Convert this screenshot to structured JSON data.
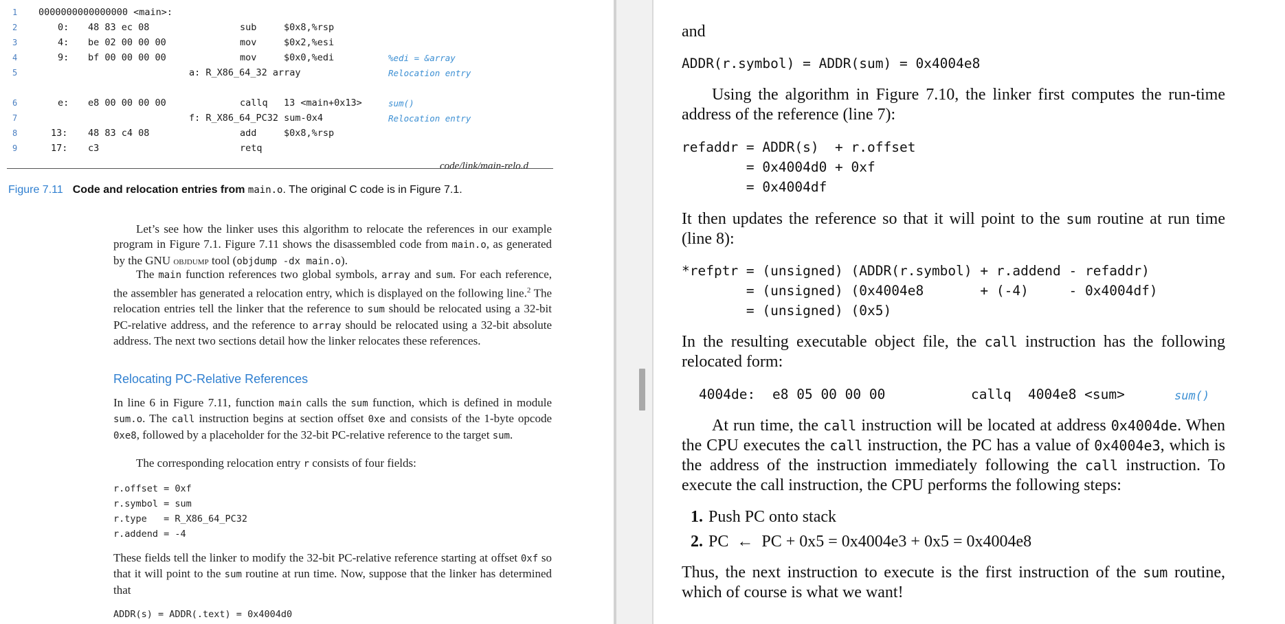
{
  "left": {
    "code_lines": [
      {
        "num": "1",
        "addr": "0000000000000000 <main>:",
        "bytes": "",
        "op": "",
        "args": "",
        "comment": ""
      },
      {
        "num": "2",
        "addr": "0:",
        "bytes": "48 83 ec 08",
        "op": "sub",
        "args": "$0x8,%rsp",
        "comment": ""
      },
      {
        "num": "3",
        "addr": "4:",
        "bytes": "be 02 00 00 00",
        "op": "mov",
        "args": "$0x2,%esi",
        "comment": ""
      },
      {
        "num": "4",
        "addr": "9:",
        "bytes": "bf 00 00 00 00",
        "op": "mov",
        "args": "$0x0,%edi",
        "comment": "%edi = &array"
      },
      {
        "num": "5",
        "addr": "",
        "bytes": "",
        "op": "a: R_X86_64_32 array",
        "args": "",
        "comment": "Relocation entry"
      },
      {
        "num": "6",
        "addr": "e:",
        "bytes": "e8 00 00 00 00",
        "op": "callq",
        "args": "13 <main+0x13>",
        "comment": "sum()"
      },
      {
        "num": "7",
        "addr": "",
        "bytes": "",
        "op": "f: R_X86_64_PC32 sum-0x4",
        "args": "",
        "comment": "Relocation entry"
      },
      {
        "num": "8",
        "addr": "13:",
        "bytes": "48 83 c4 08",
        "op": "add",
        "args": "$0x8,%rsp",
        "comment": ""
      },
      {
        "num": "9",
        "addr": "17:",
        "bytes": "c3",
        "op": "retq",
        "args": "",
        "comment": ""
      }
    ],
    "code_file": "code/link/main-relo.d",
    "figure_label": "Figure 7.11",
    "figure_caption_a": "Code and relocation entries from ",
    "figure_caption_code": "main.o",
    "figure_caption_b": ". The original C code is in Figure 7.1.",
    "para1": {
      "t1": "Let’s see how the linker uses this algorithm to relocate the references in our example program in Figure 7.1. Figure 7.11 shows the disassembled code from ",
      "c1": "main.o",
      "t2": ", as generated by the GNU ",
      "sc": "objdump",
      "t3": " tool (",
      "c2": "objdump -dx main.o",
      "t4": ")."
    },
    "para2": {
      "t1": "The ",
      "c1": "main",
      "t2": " function references two global symbols, ",
      "c2": "array",
      "t3": " and ",
      "c3": "sum",
      "t4": ". For each reference, the assembler has generated a relocation entry, which is displayed on the following line.",
      "sup": "2",
      "t5": " The relocation entries tell the linker that the reference to ",
      "c4": "sum",
      "t6": " should be relocated using a 32-bit PC-relative address, and the reference to ",
      "c5": "array",
      "t7": " should be relocated using a 32-bit absolute address. The next two sections detail how the linker relocates these references."
    },
    "subheading": "Relocating PC-Relative References",
    "para3": {
      "t1": "In line 6 in Figure 7.11, function ",
      "c1": "main",
      "t2": " calls the ",
      "c2": "sum",
      "t3": " function, which is defined in module ",
      "c3": "sum.o",
      "t4": ". The ",
      "c4": "call",
      "t5": " instruction begins at section offset ",
      "c5": "0xe",
      "t6": " and consists of the 1-byte opcode ",
      "c6": "0xe8",
      "t7": ", followed by a placeholder for the 32-bit PC-relative reference to the target ",
      "c7": "sum",
      "t8": "."
    },
    "para4": {
      "t1": "The corresponding relocation entry ",
      "c1": "r",
      "t2": " consists of four fields:"
    },
    "fields": [
      "r.offset = 0xf",
      "r.symbol = sum",
      "r.type   = R_X86_64_PC32",
      "r.addend = -4"
    ],
    "para5": {
      "t1": "These fields tell the linker to modify the 32-bit PC-relative reference starting at offset ",
      "c1": "0xf",
      "t2": " so that it will point to the ",
      "c2": "sum",
      "t3": " routine at run time. Now, suppose that the linker has determined that"
    },
    "last_line": "ADDR(s) = ADDR(.text) = 0x4004d0"
  },
  "right": {
    "and": "and",
    "addr_line": "ADDR(r.symbol) = ADDR(sum) = 0x4004e8",
    "para1": "Using the algorithm in Figure 7.10, the linker first computes the run-time address of the reference (line 7):",
    "refaddr_lines": [
      "refaddr = ADDR(s)  + r.offset",
      "        = 0x4004d0 + 0xf",
      "        = 0x4004df"
    ],
    "para2": {
      "t1": "It then updates the reference so that it will point to the ",
      "c1": "sum",
      "t2": " routine at run time (line 8):"
    },
    "refptr_lines": [
      "*refptr = (unsigned) (ADDR(r.symbol) + r.addend - refaddr)",
      "        = (unsigned) (0x4004e8       + (-4)     - 0x4004df)",
      "        = (unsigned) (0x5)"
    ],
    "para3": {
      "t1": "In the resulting executable object file, the ",
      "c1": "call",
      "t2": " instruction has the following relocated form:"
    },
    "reloc_addr": "4004de:",
    "reloc_bytes": "e8 05 00 00 00",
    "reloc_op": "callq",
    "reloc_args": "4004e8 <sum>",
    "reloc_comment": "sum()",
    "para4": {
      "t1": "At run time, the ",
      "c1": "call",
      "t2": " instruction will be located at address ",
      "c2": "0x4004de",
      "t3": ". When the CPU executes the ",
      "c3": "call",
      "t4": " instruction, the PC has a value of ",
      "c4": "0x4004e3",
      "t5": ", which is the address of the instruction immediately following the ",
      "c5": "call",
      "t6": " instruction. To execute the call instruction, the CPU performs the following steps:"
    },
    "steps": [
      {
        "num": "1.",
        "text": "Push PC onto stack"
      },
      {
        "num": "2.",
        "text": "PC  ←  PC + 0x5 = 0x4004e3 + 0x5 = 0x4004e8"
      }
    ],
    "para5": {
      "t1": "Thus, the next instruction to execute is the first instruction of the ",
      "c1": "sum",
      "t2": " routine, which of course is what we want!"
    }
  }
}
